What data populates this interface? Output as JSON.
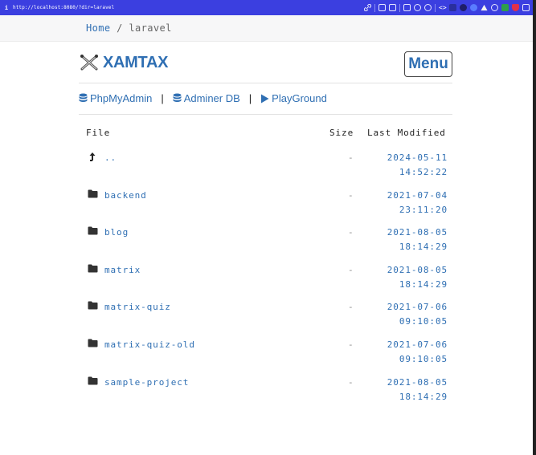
{
  "browser": {
    "info_icon": "info-icon",
    "url": "http://localhost:8080/?dir=laravel"
  },
  "breadcrumb": {
    "home": "Home",
    "separator": "/",
    "current": "laravel"
  },
  "header": {
    "brand": "XAMTAX",
    "menu_label": "Menu"
  },
  "nav": {
    "links": [
      {
        "label": "PhpMyAdmin",
        "icon": "database-icon"
      },
      {
        "label": "Adminer DB",
        "icon": "database-icon"
      },
      {
        "label": "PlayGround",
        "icon": "play-icon"
      }
    ],
    "separator": "|"
  },
  "table": {
    "headers": {
      "file": "File",
      "size": "Size",
      "modified": "Last Modified"
    },
    "rows": [
      {
        "name": "..",
        "icon": "level-up-icon",
        "size": "-",
        "date": "2024-05-11",
        "time": "14:52:22"
      },
      {
        "name": "backend",
        "icon": "folder-icon",
        "size": "-",
        "date": "2021-07-04",
        "time": "23:11:20"
      },
      {
        "name": "blog",
        "icon": "folder-icon",
        "size": "-",
        "date": "2021-08-05",
        "time": "18:14:29"
      },
      {
        "name": "matrix",
        "icon": "folder-icon",
        "size": "-",
        "date": "2021-08-05",
        "time": "18:14:29"
      },
      {
        "name": "matrix-quiz",
        "icon": "folder-icon",
        "size": "-",
        "date": "2021-07-06",
        "time": "09:10:05"
      },
      {
        "name": "matrix-quiz-old",
        "icon": "folder-icon",
        "size": "-",
        "date": "2021-07-06",
        "time": "09:10:05"
      },
      {
        "name": "sample-project",
        "icon": "folder-icon",
        "size": "-",
        "date": "2021-08-05",
        "time": "18:14:29"
      }
    ]
  },
  "colors": {
    "accent": "#2f6fb3",
    "address_bar": "#3b3fe0",
    "text": "#222222",
    "muted": "#888888"
  }
}
